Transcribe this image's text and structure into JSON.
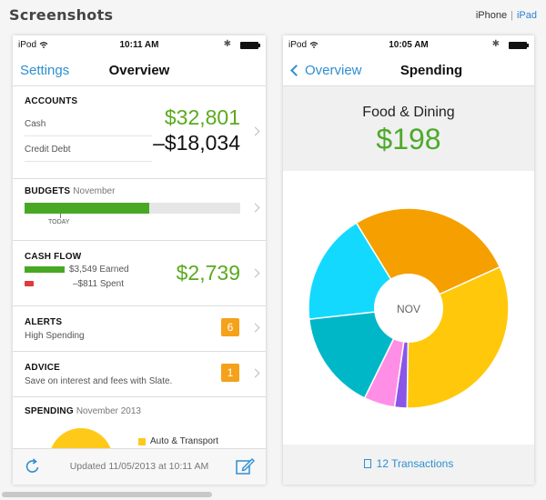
{
  "header": {
    "title": "Screenshots",
    "device_iphone": "iPhone",
    "device_separator": "|",
    "device_ipad": "iPad"
  },
  "left_phone": {
    "status": {
      "carrier": "iPod",
      "time": "10:11 AM"
    },
    "nav": {
      "left": "Settings",
      "title": "Overview"
    },
    "accounts": {
      "label": "ACCOUNTS",
      "cash_label": "Cash",
      "cash_value": "$32,801",
      "debt_label": "Credit Debt",
      "debt_value": "–$18,034"
    },
    "budgets": {
      "label": "BUDGETS",
      "month": "November",
      "today_label": "TODAY",
      "progress_fraction": 0.58
    },
    "cash_flow": {
      "label": "CASH FLOW",
      "earned": "$3,549 Earned",
      "spent": "–$811 Spent",
      "net": "$2,739"
    },
    "alerts": {
      "label": "ALERTS",
      "detail": "High Spending",
      "count": "6"
    },
    "advice": {
      "label": "ADVICE",
      "detail": "Save on interest and fees with Slate.",
      "count": "1"
    },
    "spending": {
      "label": "SPENDING",
      "period": "November 2013",
      "legend_first": "Auto & Transport"
    },
    "toolbar": {
      "updated": "Updated 11/05/2013 at 10:11 AM"
    }
  },
  "right_phone": {
    "status": {
      "carrier": "iPod",
      "time": "10:05 AM"
    },
    "nav": {
      "back": "Overview",
      "title": "Spending"
    },
    "category": {
      "name": "Food & Dining",
      "amount": "$198"
    },
    "pie_center": "NOV",
    "transactions_link": "12 Transactions",
    "pie_segments": [
      {
        "color": "#f5a000",
        "fraction": 0.27
      },
      {
        "color": "#ffc80a",
        "fraction": 0.32
      },
      {
        "color": "#8a55e8",
        "fraction": 0.02
      },
      {
        "color": "#ff8fe6",
        "fraction": 0.05
      },
      {
        "color": "#00b7c8",
        "fraction": 0.16
      },
      {
        "color": "#14d9ff",
        "fraction": 0.18
      }
    ]
  },
  "colors": {
    "accent_blue": "#2d8fd0",
    "positive_green": "#5aaa1e",
    "badge_orange": "#f5a11a",
    "spent_red": "#e03a3a"
  },
  "icons": [
    "wifi-icon",
    "bluetooth-icon",
    "battery-icon",
    "chevron-right-icon",
    "refresh-icon",
    "compose-icon",
    "chevron-left-icon",
    "document-icon"
  ]
}
